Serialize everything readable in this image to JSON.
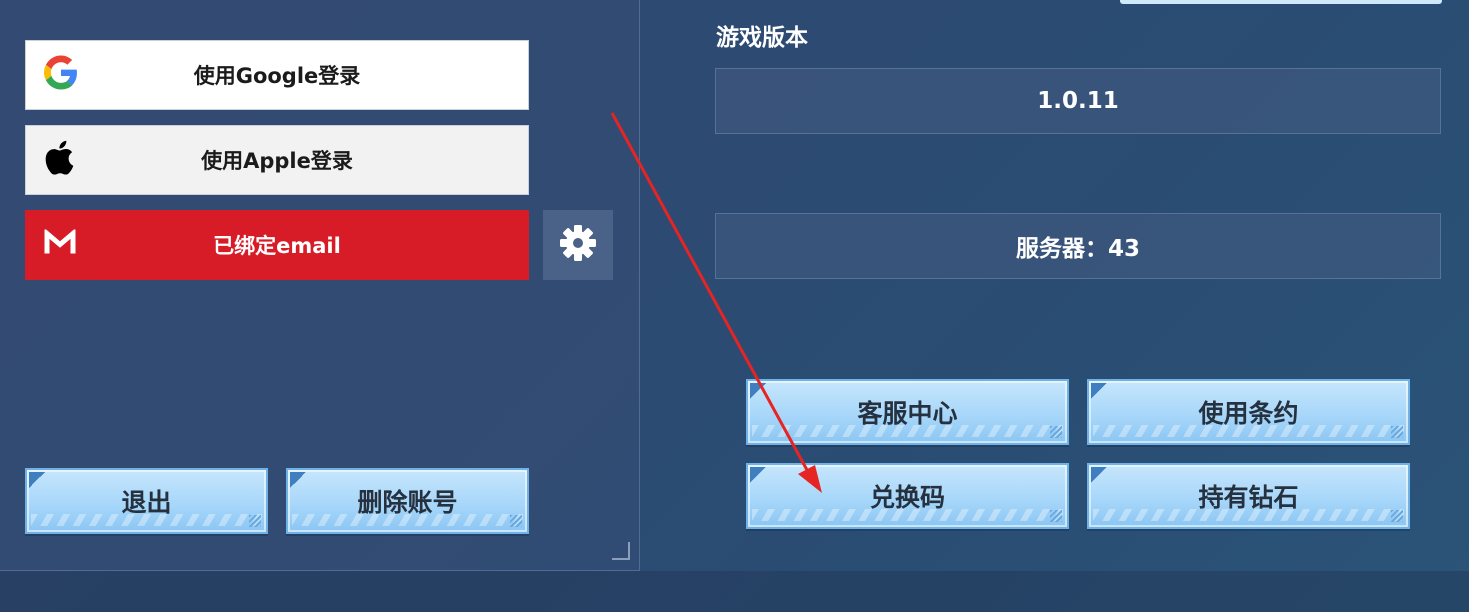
{
  "login_buttons": {
    "google_label": "使用Google登录",
    "apple_label": "使用Apple登录",
    "email_label": "已绑定email"
  },
  "settings": {
    "icon": "gear-icon"
  },
  "version": {
    "label": "游戏版本",
    "value": "1.0.11"
  },
  "server": {
    "text": "服务器：43"
  },
  "action_buttons": {
    "support": "客服中心",
    "terms": "使用条约",
    "redeem": "兑换码",
    "diamonds": "持有钻石"
  },
  "account_buttons": {
    "logout": "退出",
    "delete": "删除账号"
  },
  "colors": {
    "email_red": "#d71b27",
    "button_blue": "#a8d7fa",
    "arrow_red": "#e62424"
  }
}
